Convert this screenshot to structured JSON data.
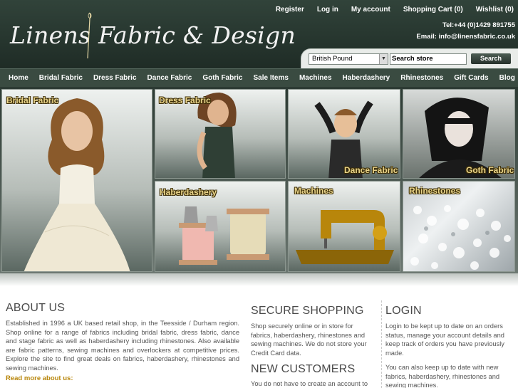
{
  "brand": {
    "logo_text": "Linens Fabric & Design"
  },
  "toplinks": [
    "Register",
    "Log in",
    "My account",
    "Shopping Cart (0)",
    "Wishlist (0)"
  ],
  "contact": {
    "tel": "Tel:+44 (0)1429 891755",
    "email": "Email: info@linensfabric.co.uk"
  },
  "search": {
    "currency_selected": "British Pound",
    "input_value": "Search store",
    "button_label": "Search"
  },
  "nav": [
    "Home",
    "Bridal Fabric",
    "Dress Fabric",
    "Dance Fabric",
    "Goth Fabric",
    "Sale Items",
    "Machines",
    "Haberdashery",
    "Rhinestones",
    "Gift Cards",
    "Blog"
  ],
  "banner_tiles": [
    "Bridal Fabric",
    "Dress Fabric",
    "Dance Fabric",
    "Goth Fabric",
    "Haberdashery",
    "Machines",
    "Rhinestones"
  ],
  "about": {
    "title": "ABOUT US",
    "body": "Established in 1996 a UK based retail shop, in the Teesside / Durham region. Shop online for a range of fabrics including bridal fabric, dress fabric, dance and stage fabric as well as haberdashery including rhinestones. Also available are fabric patterns, sewing machines and overlockers at competitive prices. Explore the site to find great deals on fabrics, haberdashery, rhinestones and sewing machines.",
    "read_more": "Read more about us:"
  },
  "secure": {
    "title": "SECURE SHOPPING",
    "body": "Shop securely online or in store for fabrics, haberdashery, rhinestones and sewing machines. We do not store your Credit Card data."
  },
  "new_customers": {
    "title": "NEW CUSTOMERS",
    "body": "You do not have to create an account to use"
  },
  "login": {
    "title": "LOGIN",
    "body1": "Login to be kept up to date on an orders status, manage your account details and keep track of orders you have previously made.",
    "body2": "You can also keep up to date with new fabrics, haberdashery, rhinestones and sewing machines."
  },
  "colors": {
    "header_bg": "#2a3931",
    "nav_bg": "#3a4b41",
    "label_gold": "#e9d48a",
    "link_gold": "#b8860b"
  }
}
